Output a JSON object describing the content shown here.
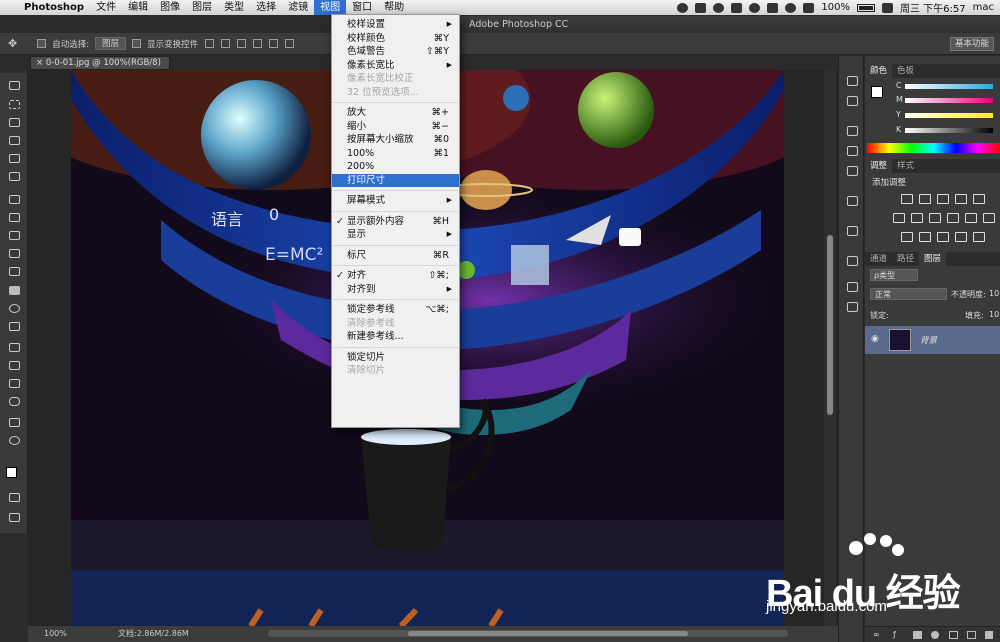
{
  "menubar": {
    "apple": "",
    "app": "Photoshop",
    "items": [
      "文件",
      "编辑",
      "图像",
      "图层",
      "类型",
      "选择",
      "滤镜",
      "视图",
      "窗口",
      "帮助"
    ]
  },
  "status": {
    "battery": "100%",
    "time": "周三 下午6:57",
    "user": "mac"
  },
  "window_title": "Adobe Photoshop CC",
  "options": {
    "auto_select_label": "自动选择:",
    "auto_select_value": "图层",
    "show_transform": "显示变换控件",
    "workspace": "基本功能"
  },
  "doc_tab": "0-0-01.jpg @ 100%(RGB/8)",
  "bottombar": {
    "zoom": "100%",
    "doc": "文档:2.86M/2.86M"
  },
  "color_panel": {
    "tabs": [
      "颜色",
      "色板"
    ],
    "channels": [
      "C",
      "M",
      "Y",
      "K"
    ],
    "channel_colors": [
      "#29abe2",
      "#e5007f",
      "#fff000",
      "#555555"
    ]
  },
  "adjust_panel": {
    "tabs": [
      "调整",
      "样式"
    ],
    "heading": "添加调整"
  },
  "layers_panel": {
    "tabs": [
      "通道",
      "路径",
      "图层"
    ],
    "filter": "ρ类型",
    "blend": "正常",
    "opacity_label": "不透明度:",
    "opacity": "10",
    "lock_label": "锁定:",
    "fill_label": "填充:",
    "fill": "10",
    "layer_name": "背景"
  },
  "view_menu": [
    {
      "label": "校样设置",
      "arrow": "▶"
    },
    {
      "label": "校样颜色",
      "shortcut": "⌘Y"
    },
    {
      "label": "色域警告",
      "shortcut": "⇧⌘Y"
    },
    {
      "label": "像素长宽比",
      "arrow": "▶"
    },
    {
      "label": "像素长宽比校正",
      "disabled": true
    },
    {
      "label": "32 位预览选项...",
      "disabled": true
    },
    {
      "sep": true
    },
    {
      "label": "放大",
      "shortcut": "⌘+"
    },
    {
      "label": "缩小",
      "shortcut": "⌘−"
    },
    {
      "label": "按屏幕大小缩放",
      "shortcut": "⌘0"
    },
    {
      "label": "100%",
      "shortcut": "⌘1"
    },
    {
      "label": "200%"
    },
    {
      "label": "打印尺寸",
      "highlight": true
    },
    {
      "sep": true
    },
    {
      "label": "屏幕模式",
      "arrow": "▶"
    },
    {
      "sep": true
    },
    {
      "label": "显示额外内容",
      "shortcut": "⌘H",
      "check": true
    },
    {
      "label": "显示",
      "arrow": "▶"
    },
    {
      "sep": true
    },
    {
      "label": "标尺",
      "shortcut": "⌘R"
    },
    {
      "sep": true
    },
    {
      "label": "对齐",
      "shortcut": "⇧⌘;",
      "check": true
    },
    {
      "label": "对齐到",
      "arrow": "▶"
    },
    {
      "sep": true
    },
    {
      "label": "锁定参考线",
      "shortcut": "⌥⌘;"
    },
    {
      "label": "清除参考线",
      "disabled": true
    },
    {
      "label": "新建参考线..."
    },
    {
      "sep": true
    },
    {
      "label": "锁定切片"
    },
    {
      "label": "清除切片",
      "disabled": true
    }
  ],
  "artwork": {
    "t1": "语言",
    "t2": "0",
    "t3": "E=MC²"
  },
  "watermark": {
    "brand": "Bai du 经验",
    "url": "jingyan.baidu.com"
  }
}
